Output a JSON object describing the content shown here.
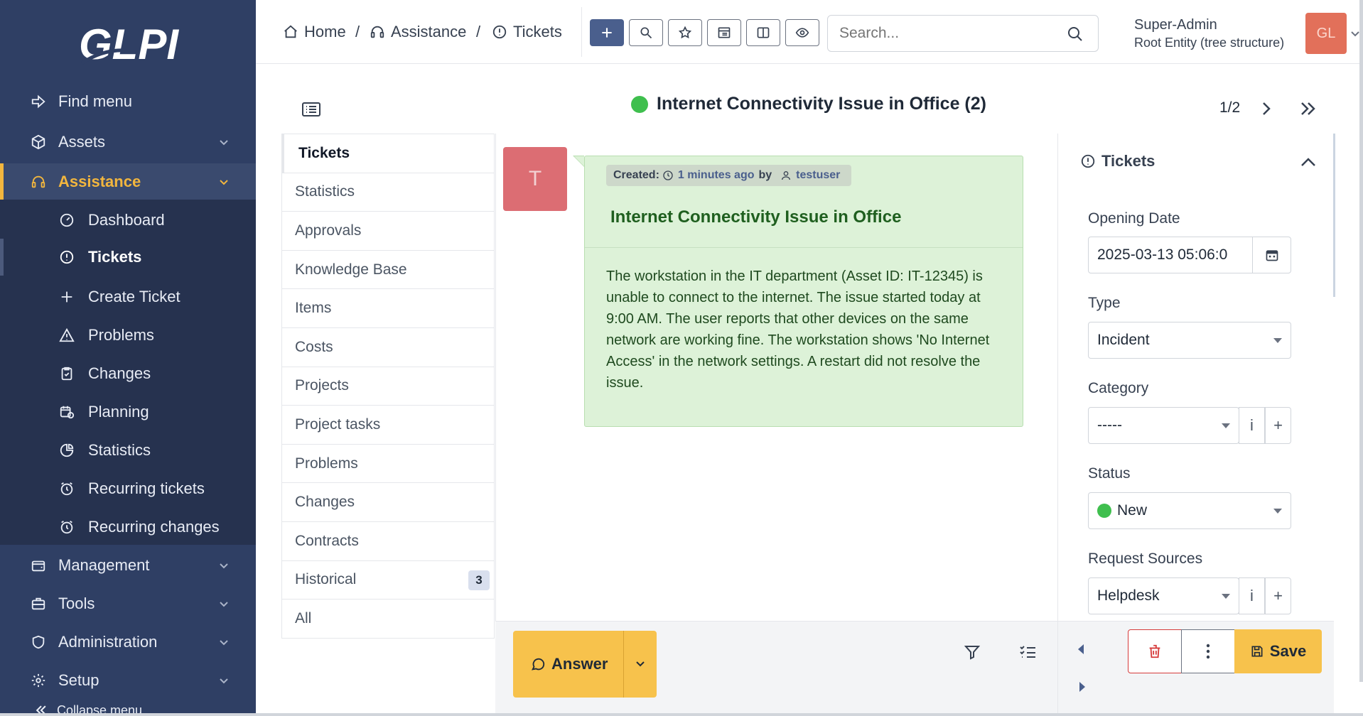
{
  "sidebar": {
    "logo_text": "GLPI",
    "find_menu": "Find menu",
    "items": [
      {
        "label": "Assets"
      },
      {
        "label": "Assistance"
      },
      {
        "label": "Dashboard"
      },
      {
        "label": "Tickets"
      },
      {
        "label": "Create Ticket"
      },
      {
        "label": "Problems"
      },
      {
        "label": "Changes"
      },
      {
        "label": "Planning"
      },
      {
        "label": "Statistics"
      },
      {
        "label": "Recurring tickets"
      },
      {
        "label": "Recurring changes"
      },
      {
        "label": "Management"
      },
      {
        "label": "Tools"
      },
      {
        "label": "Administration"
      },
      {
        "label": "Setup"
      }
    ],
    "collapse": "Collapse menu",
    "accent_color": "#f2b63e"
  },
  "header": {
    "breadcrumbs": [
      "Home",
      "Assistance",
      "Tickets"
    ],
    "search_placeholder": "Search...",
    "user_name": "Super-Admin",
    "user_entity": "Root Entity (tree structure)",
    "avatar_initials": "GL"
  },
  "ticket": {
    "title": "Internet Connectivity Issue in Office (2)",
    "pager": "1/2"
  },
  "tabs": [
    {
      "label": "Tickets"
    },
    {
      "label": "Statistics"
    },
    {
      "label": "Approvals"
    },
    {
      "label": "Knowledge Base"
    },
    {
      "label": "Items"
    },
    {
      "label": "Costs"
    },
    {
      "label": "Projects"
    },
    {
      "label": "Project tasks"
    },
    {
      "label": "Problems"
    },
    {
      "label": "Changes"
    },
    {
      "label": "Contracts"
    },
    {
      "label": "Historical",
      "badge": "3"
    },
    {
      "label": "All"
    }
  ],
  "timeline": {
    "avatar_letter": "T",
    "created_label": "Created:",
    "created_time": "1 minutes ago",
    "by_label": "by",
    "author": "testuser",
    "item_title": "Internet Connectivity Issue in Office",
    "body": "The workstation in the IT department (Asset ID: IT-12345) is unable to connect to the internet. The issue started today at 9:00 AM. The user reports that other devices on the same network are working fine. The workstation shows 'No Internet Access' in the network settings. A restart did not resolve the issue."
  },
  "panel": {
    "header": "Tickets",
    "opening_date_label": "Opening Date",
    "opening_date": "2025-03-13 05:06:0",
    "type_label": "Type",
    "type_value": "Incident",
    "category_label": "Category",
    "category_value": "-----",
    "status_label": "Status",
    "status_value": "New",
    "request_source_label": "Request Sources",
    "request_source_value": "Helpdesk",
    "info_glyph": "i",
    "add_glyph": "+"
  },
  "footer": {
    "answer_label": "Answer",
    "save_label": "Save"
  }
}
